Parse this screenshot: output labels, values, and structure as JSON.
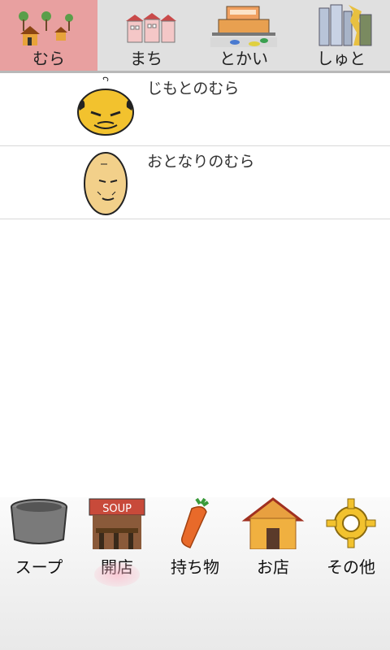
{
  "top_tabs": [
    {
      "label": "むら",
      "icon": "village-icon"
    },
    {
      "label": "まち",
      "icon": "town-icon"
    },
    {
      "label": "とかい",
      "icon": "city-icon"
    },
    {
      "label": "しゅと",
      "icon": "capital-icon"
    }
  ],
  "list": [
    {
      "title": "じもとのむら",
      "icon": "bald-elder-face-icon"
    },
    {
      "title": "おとなりのむら",
      "icon": "old-man-face-icon"
    }
  ],
  "bottom_nav": [
    {
      "label": "スープ",
      "icon": "soup-pot-icon"
    },
    {
      "label": "開店",
      "icon": "soup-stall-icon",
      "stall_sign": "SOUP"
    },
    {
      "label": "持ち物",
      "icon": "carrot-icon"
    },
    {
      "label": "お店",
      "icon": "shop-icon"
    },
    {
      "label": "その他",
      "icon": "gear-icon"
    }
  ],
  "colors": {
    "active_tab": "#e8a0a0",
    "tab_bar": "#e0e0e0"
  }
}
